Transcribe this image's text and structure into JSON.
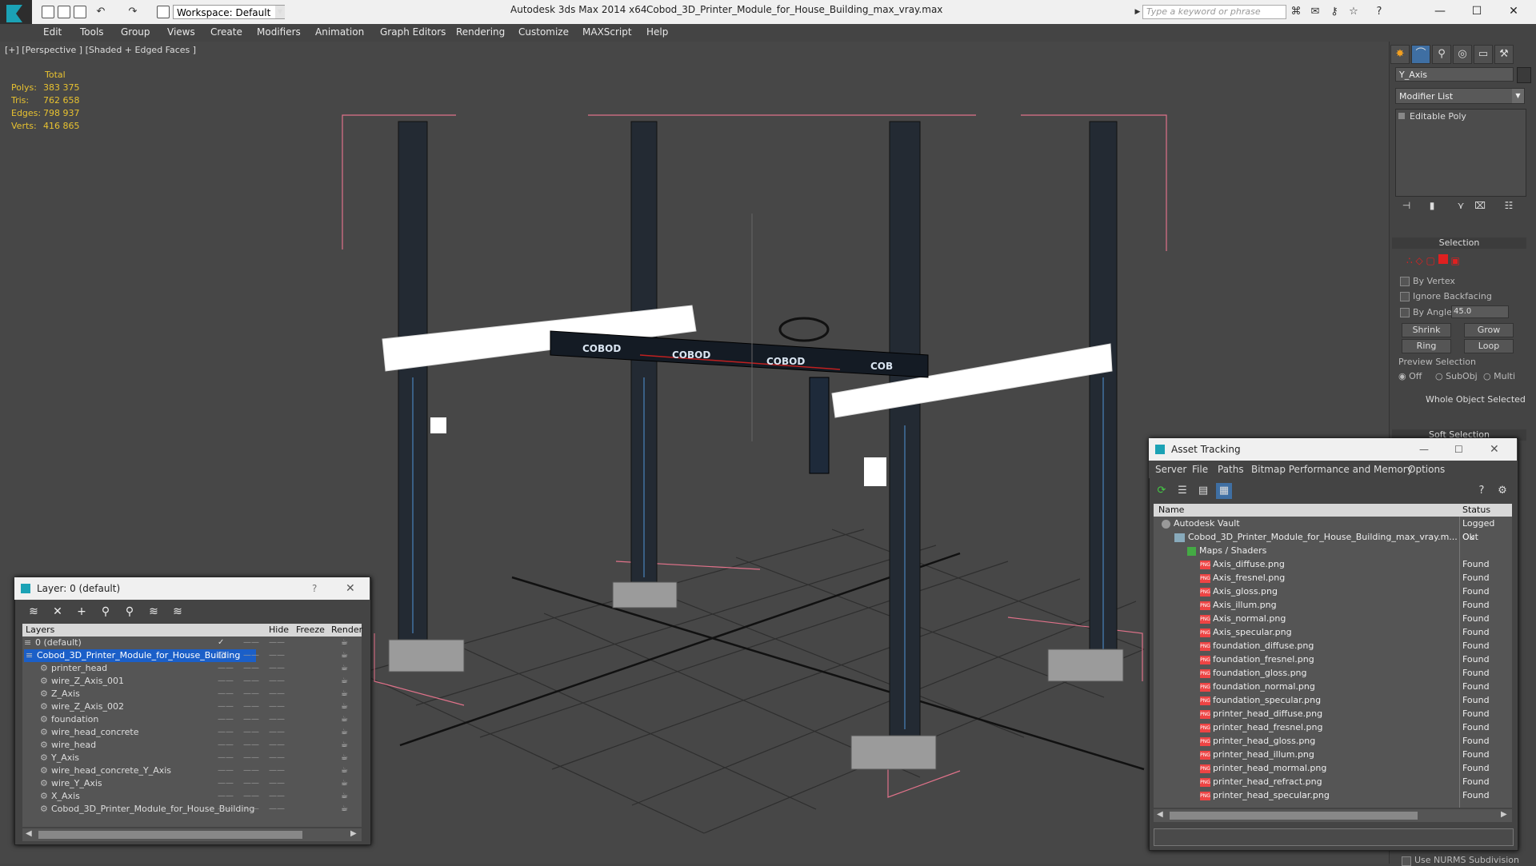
{
  "app": {
    "name": "Autodesk 3ds Max  2014 x64",
    "document": "Cobod_3D_Printer_Module_for_House_Building_max_vray.max",
    "workspace": "Workspace: Default",
    "search_placeholder": "Type a keyword or phrase"
  },
  "menu": [
    "Edit",
    "Tools",
    "Group",
    "Views",
    "Create",
    "Modifiers",
    "Animation",
    "Graph Editors",
    "Rendering",
    "Customize",
    "MAXScript",
    "Help"
  ],
  "viewport": {
    "label": "[+] [Perspective ] [Shaded + Edged Faces ]",
    "stats_header": "Total",
    "stats": [
      {
        "k": "Polys:",
        "v": "383 375"
      },
      {
        "k": "Tris:",
        "v": "762 658"
      },
      {
        "k": "Edges:",
        "v": "798 937"
      },
      {
        "k": "Verts:",
        "v": "416 865"
      }
    ],
    "beam_text": [
      "COBOD",
      "COBOD",
      "COBOD",
      "COB"
    ]
  },
  "cmdpanel": {
    "object_name": "Y_Axis",
    "modifier_list": "Modifier List",
    "stack_item": "Editable Poly",
    "selection": {
      "header": "Selection",
      "by_vertex": "By Vertex",
      "ignore_backfacing": "Ignore Backfacing",
      "by_angle": "By Angle:",
      "angle_value": "45.0",
      "shrink": "Shrink",
      "grow": "Grow",
      "ring": "Ring",
      "loop": "Loop",
      "preview": "Preview Selection",
      "off": "Off",
      "subobj": "SubObj",
      "multi": "Multi",
      "whole": "Whole Object Selected"
    },
    "soft_selection": "Soft Selection",
    "nurms": "Use NURMS Subdivision"
  },
  "layer_dialog": {
    "title": "Layer: 0 (default)",
    "help": "?",
    "columns": [
      "Layers",
      "Hide",
      "Freeze",
      "Render"
    ],
    "rows": [
      {
        "name": "0 (default)",
        "level": 0
      },
      {
        "name": "Cobod_3D_Printer_Module_for_House_Building",
        "level": 0,
        "selected": true
      },
      {
        "name": "printer_head",
        "level": 1
      },
      {
        "name": "wire_Z_Axis_001",
        "level": 1
      },
      {
        "name": "Z_Axis",
        "level": 1
      },
      {
        "name": "wire_Z_Axis_002",
        "level": 1
      },
      {
        "name": "foundation",
        "level": 1
      },
      {
        "name": "wire_head_concrete",
        "level": 1
      },
      {
        "name": "wire_head",
        "level": 1
      },
      {
        "name": "Y_Axis",
        "level": 1
      },
      {
        "name": "wire_head_concrete_Y_Axis",
        "level": 1
      },
      {
        "name": "wire_Y_Axis",
        "level": 1
      },
      {
        "name": "X_Axis",
        "level": 1
      },
      {
        "name": "Cobod_3D_Printer_Module_for_House_Building",
        "level": 1
      }
    ]
  },
  "asset_dialog": {
    "title": "Asset Tracking",
    "menu": [
      "Server",
      "File",
      "Paths",
      "Bitmap Performance and Memory",
      "Options"
    ],
    "columns": [
      "Name",
      "Status"
    ],
    "rows": [
      {
        "name": "Autodesk Vault",
        "status": "Logged Out",
        "level": 0,
        "icon": "vault"
      },
      {
        "name": "Cobod_3D_Printer_Module_for_House_Building_max_vray.m...",
        "status": "Ok",
        "level": 1,
        "icon": "max"
      },
      {
        "name": "Maps / Shaders",
        "status": "",
        "level": 2,
        "icon": "maps"
      },
      {
        "name": "Axis_diffuse.png",
        "status": "Found",
        "level": 3,
        "icon": "png"
      },
      {
        "name": "Axis_fresnel.png",
        "status": "Found",
        "level": 3,
        "icon": "png"
      },
      {
        "name": "Axis_gloss.png",
        "status": "Found",
        "level": 3,
        "icon": "png"
      },
      {
        "name": "Axis_illum.png",
        "status": "Found",
        "level": 3,
        "icon": "png"
      },
      {
        "name": "Axis_normal.png",
        "status": "Found",
        "level": 3,
        "icon": "png"
      },
      {
        "name": "Axis_specular.png",
        "status": "Found",
        "level": 3,
        "icon": "png"
      },
      {
        "name": "foundation_diffuse.png",
        "status": "Found",
        "level": 3,
        "icon": "png"
      },
      {
        "name": "foundation_fresnel.png",
        "status": "Found",
        "level": 3,
        "icon": "png"
      },
      {
        "name": "foundation_gloss.png",
        "status": "Found",
        "level": 3,
        "icon": "png"
      },
      {
        "name": "foundation_normal.png",
        "status": "Found",
        "level": 3,
        "icon": "png"
      },
      {
        "name": "foundation_specular.png",
        "status": "Found",
        "level": 3,
        "icon": "png"
      },
      {
        "name": "printer_head_diffuse.png",
        "status": "Found",
        "level": 3,
        "icon": "png"
      },
      {
        "name": "printer_head_fresnel.png",
        "status": "Found",
        "level": 3,
        "icon": "png"
      },
      {
        "name": "printer_head_gloss.png",
        "status": "Found",
        "level": 3,
        "icon": "png"
      },
      {
        "name": "printer_head_illum.png",
        "status": "Found",
        "level": 3,
        "icon": "png"
      },
      {
        "name": "printer_head_mormal.png",
        "status": "Found",
        "level": 3,
        "icon": "png"
      },
      {
        "name": "printer_head_refract.png",
        "status": "Found",
        "level": 3,
        "icon": "png"
      },
      {
        "name": "printer_head_specular.png",
        "status": "Found",
        "level": 3,
        "icon": "png"
      }
    ]
  },
  "colors": {
    "selection_blue": "#1b5fc8",
    "stats_yellow": "#e8c230",
    "accent_teal": "#1ba2b5",
    "frame_pink": "#e0728a",
    "subobj_red": "#e02020"
  }
}
